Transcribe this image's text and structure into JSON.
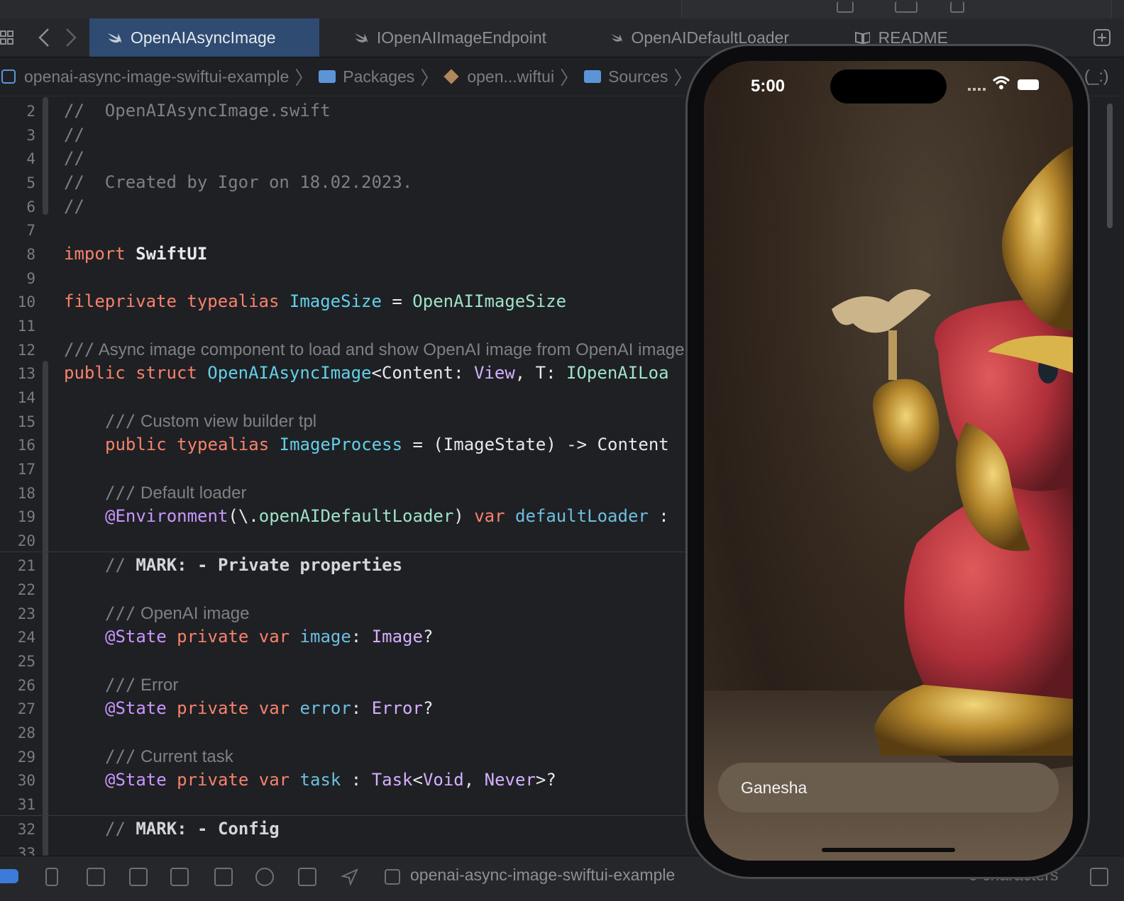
{
  "window": {
    "tabs": [
      {
        "label": "OpenAIAsyncImage",
        "active": true
      },
      {
        "label": "IOpenAIImageEndpoint",
        "active": false
      },
      {
        "label": "OpenAIDefaultLoader",
        "active": false
      },
      {
        "label": "README",
        "active": false
      }
    ]
  },
  "breadcrumb": {
    "items": [
      "openai-async-image-swiftui-example",
      "Packages",
      "open...wiftui",
      "Sources"
    ],
    "trailing": "(_:)"
  },
  "editor": {
    "line_numbers": [
      "2",
      "3",
      "4",
      "5",
      "6",
      "7",
      "8",
      "9",
      "10",
      "11",
      "12",
      "13",
      "14",
      "15",
      "16",
      "17",
      "18",
      "19",
      "20",
      "21",
      "22",
      "23",
      "24",
      "25",
      "26",
      "27",
      "28",
      "29",
      "30",
      "31",
      "32",
      "33"
    ],
    "tokens": {
      "l2": "//  OpenAIAsyncImage.swift",
      "l3": "//",
      "l4": "//",
      "l5": "//  Created by Igor on 18.02.2023.",
      "l6": "//",
      "import_kw": "import",
      "import_mod": " SwiftUI",
      "fileprivate_kw": "fileprivate typealias",
      "imgsize": " ImageSize",
      "eq": " = ",
      "oaimgsize": "OpenAIImageSize",
      "l12_slashes": "///",
      "l12_doc": " Async image component to load and show OpenAI image from OpenAI image",
      "l13_kw": "public struct",
      "l13_name": " OpenAIAsyncImage",
      "l13_generic": "<Content: ",
      "l13_view": "View",
      "l13_t": ", T: ",
      "l13_loader": "IOpenAILoa",
      "l15_slashes": "///",
      "l15_doc": " Custom view builder tpl",
      "l16_kw": "public typealias",
      "l16_name": " ImageProcess",
      "l16_rest": " = (ImageState) -> Content",
      "l18_slashes": "///",
      "l18_doc": " Default loader",
      "l19_attr": "@Environment",
      "l19_args": "(\\.",
      "l19_key": "openAIDefaultLoader",
      "l19_close": ") ",
      "l19_var": "var",
      "l19_name": " defaultLoader",
      "l19_colon": " :",
      "l21_com": "// ",
      "l21_mark": "MARK: - Private properties",
      "l23_slashes": "///",
      "l23_doc": " OpenAI image",
      "l24_attr": "@State",
      "l24_kw": " private var",
      "l24_name": " image",
      "l24_colon": ": ",
      "l24_type": "Image",
      "l24_q": "?",
      "l26_slashes": "///",
      "l26_doc": " Error",
      "l27_attr": "@State",
      "l27_kw": " private var",
      "l27_name": " error",
      "l27_colon": ": ",
      "l27_type": "Error",
      "l27_q": "?",
      "l29_slashes": "///",
      "l29_doc": " Current task",
      "l30_attr": "@State",
      "l30_kw": " private var",
      "l30_name": " task",
      "l30_colon": " : ",
      "l30_type": "Task",
      "l30_lt": "<",
      "l30_void": "Void",
      "l30_comma": ", ",
      "l30_never": "Never",
      "l30_gt": ">?",
      "l32_com": "// ",
      "l32_mark": "MARK: - Config"
    }
  },
  "statusbar": {
    "scheme": "openai-async-image-swiftui-example",
    "right_text": "0 characters"
  },
  "simulator": {
    "time": "5:00",
    "prompt_field_value": "Ganesha"
  },
  "colors": {
    "accent_tab": "#2f4b72",
    "keyword": "#f7826b",
    "type": "#62d0e8",
    "comment": "#7e8086"
  }
}
